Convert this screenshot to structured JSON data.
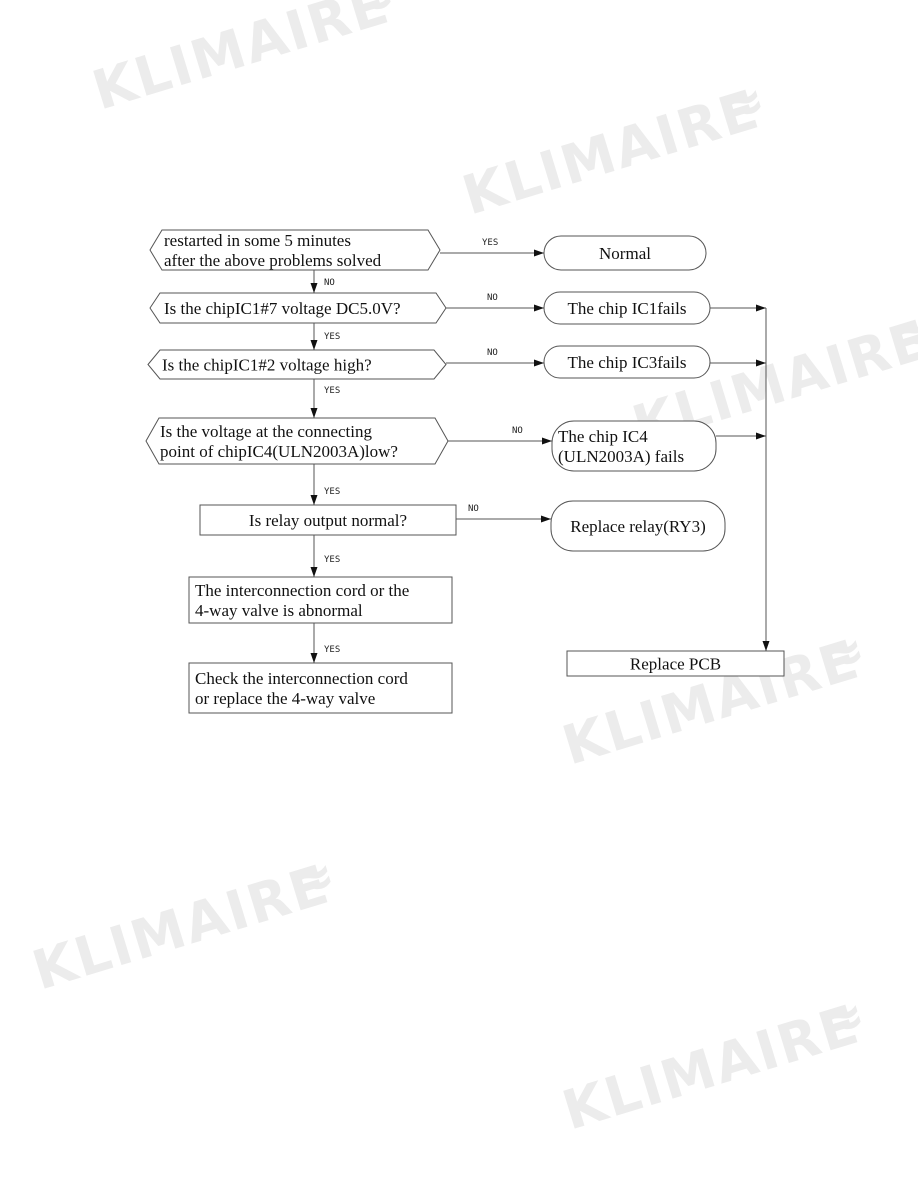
{
  "watermark": {
    "text": "KLIMAIRE",
    "symbol": "≈",
    "registered": "®"
  },
  "nodes": {
    "q_restart": {
      "type": "decision",
      "lines": [
        "restarted in some 5 minutes",
        "after the above problems solved"
      ]
    },
    "normal": {
      "type": "terminal",
      "lines": [
        "Normal"
      ]
    },
    "q_ic1_7": {
      "type": "decision",
      "lines": [
        "Is the chipIC1#7 voltage DC5.0V?"
      ]
    },
    "ic1_fails": {
      "type": "terminal",
      "lines": [
        "The chip IC1fails"
      ]
    },
    "q_ic1_2": {
      "type": "decision",
      "lines": [
        "Is the chipIC1#2 voltage high?"
      ]
    },
    "ic3_fails": {
      "type": "terminal",
      "lines": [
        "The chip IC3fails"
      ]
    },
    "q_ic4": {
      "type": "decision",
      "lines": [
        "Is the voltage at the connecting",
        "point of chipIC4(ULN2003A)low?"
      ]
    },
    "ic4_fails": {
      "type": "terminal",
      "lines": [
        "The chip IC4",
        "(ULN2003A) fails"
      ]
    },
    "q_relay": {
      "type": "process",
      "lines": [
        "Is relay output normal?"
      ]
    },
    "replace_relay": {
      "type": "terminal",
      "lines": [
        "Replace relay(RY3)"
      ]
    },
    "cord_abnormal": {
      "type": "process",
      "lines": [
        "The interconnection cord or the",
        "4-way valve is abnormal"
      ]
    },
    "check_cord": {
      "type": "process",
      "lines": [
        "Check the interconnection cord",
        "or replace the 4-way valve"
      ]
    },
    "replace_pcb": {
      "type": "process",
      "lines": [
        "Replace PCB"
      ]
    }
  },
  "edges": [
    {
      "from": "q_restart",
      "to": "normal",
      "label": "YES"
    },
    {
      "from": "q_restart",
      "to": "q_ic1_7",
      "label": "NO"
    },
    {
      "from": "q_ic1_7",
      "to": "ic1_fails",
      "label": "NO"
    },
    {
      "from": "q_ic1_7",
      "to": "q_ic1_2",
      "label": "YES"
    },
    {
      "from": "q_ic1_2",
      "to": "ic3_fails",
      "label": "NO"
    },
    {
      "from": "q_ic1_2",
      "to": "q_ic4",
      "label": "YES"
    },
    {
      "from": "q_ic4",
      "to": "ic4_fails",
      "label": "NO"
    },
    {
      "from": "q_ic4",
      "to": "q_relay",
      "label": "YES"
    },
    {
      "from": "q_relay",
      "to": "replace_relay",
      "label": "NO"
    },
    {
      "from": "q_relay",
      "to": "cord_abnormal",
      "label": "YES"
    },
    {
      "from": "cord_abnormal",
      "to": "check_cord",
      "label": "YES"
    },
    {
      "from": "ic1_fails",
      "to": "replace_pcb",
      "label": ""
    },
    {
      "from": "ic3_fails",
      "to": "replace_pcb",
      "label": ""
    },
    {
      "from": "ic4_fails",
      "to": "replace_pcb",
      "label": ""
    }
  ]
}
